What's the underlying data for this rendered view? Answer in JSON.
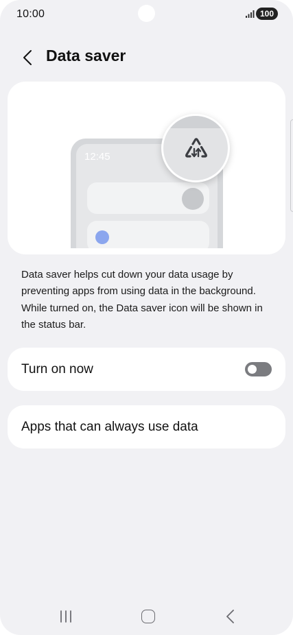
{
  "status_bar": {
    "time": "10:00",
    "battery": "100",
    "signal_icon": "signal-icon"
  },
  "header": {
    "title": "Data saver",
    "back_icon": "back-arrow-icon"
  },
  "illustration": {
    "mock_time": "12:45",
    "icon": "data-saver-icon",
    "accent_color": "#8ba6ee"
  },
  "description": "Data saver helps cut down your data usage by preventing apps from using data in the background. While turned on, the Data saver icon will be shown in the status bar.",
  "settings": {
    "turn_on_now": {
      "label": "Turn on now",
      "enabled": false
    },
    "apps_always_use_data": {
      "label": "Apps that can always use data"
    }
  },
  "nav_bar": {
    "recents_icon": "recents-icon",
    "home_icon": "home-icon",
    "back_icon": "back-icon"
  }
}
